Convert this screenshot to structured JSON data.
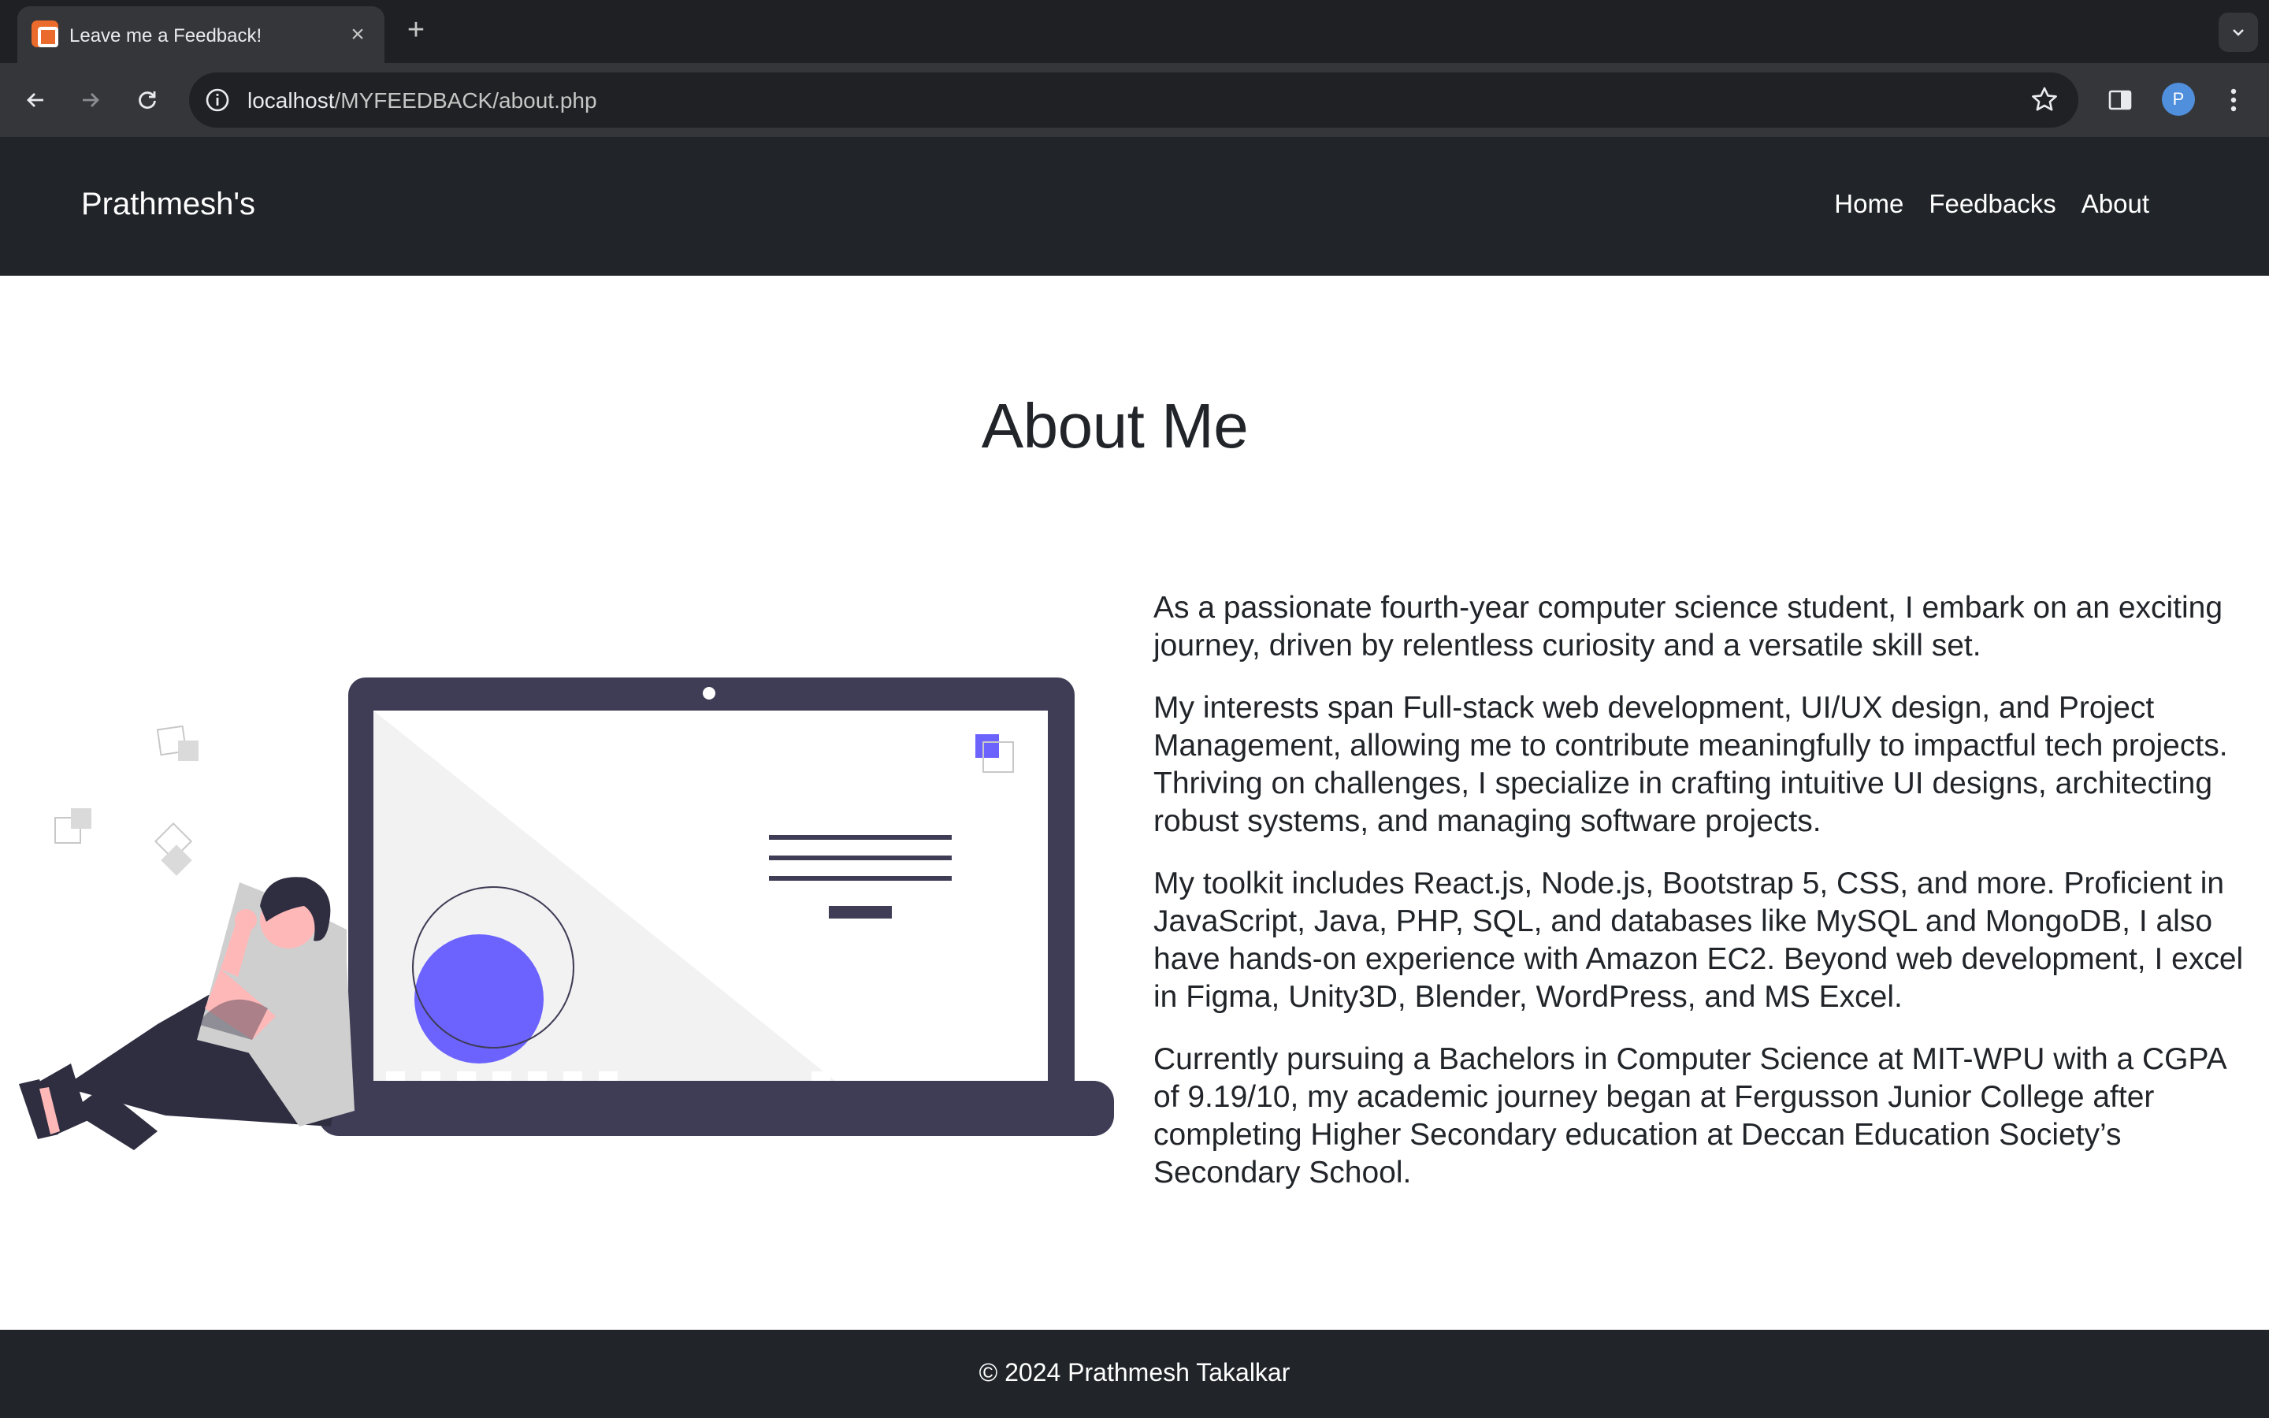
{
  "browser": {
    "tab_title": "Leave me a Feedback!",
    "url_host": "localhost",
    "url_path": "/MYFEEDBACK/about.php",
    "profile_initial": "P",
    "icons": [
      "favicon-icon",
      "close-icon",
      "new-tab-icon",
      "tab-search-icon",
      "back-icon",
      "forward-icon",
      "reload-icon",
      "info-icon",
      "bookmark-star-icon",
      "side-panel-icon",
      "menu-kebab-icon"
    ]
  },
  "navbar": {
    "brand": "Prathmesh's",
    "links": [
      "Home",
      "Feedbacks",
      "About"
    ]
  },
  "main": {
    "title": "About Me",
    "paragraphs": [
      "As a passionate fourth-year computer science student, I embark on an exciting journey, driven by relentless curiosity and a versatile skill set.",
      "My interests span Full-stack web development, UI/UX design, and Project Management, allowing me to contribute meaningfully to impactful tech projects. Thriving on challenges, I specialize in crafting intuitive UI designs, architecting robust systems, and managing software projects.",
      "My toolkit includes React.js, Node.js, Bootstrap 5, CSS, and more. Proficient in JavaScript, Java, PHP, SQL, and databases like MySQL and MongoDB, I also have hands-on experience with Amazon EC2. Beyond web development, I excel in Figma, Unity3D, Blender, WordPress, and MS Excel.",
      "Currently pursuing a Bachelors in Computer Science at MIT-WPU with a CGPA of 9.19/10, my academic journey began at Fergusson Junior College after completing Higher Secondary education at Deccan Education Society’s Secondary School."
    ]
  },
  "footer": {
    "text": "© 2024 Prathmesh Takalkar"
  },
  "colors": {
    "chrome_dark": "#1f2023",
    "chrome_toolbar": "#35363a",
    "nav_bg": "#212529",
    "accent_purple": "#6c63ff",
    "laptop_dark": "#3f3d56"
  }
}
